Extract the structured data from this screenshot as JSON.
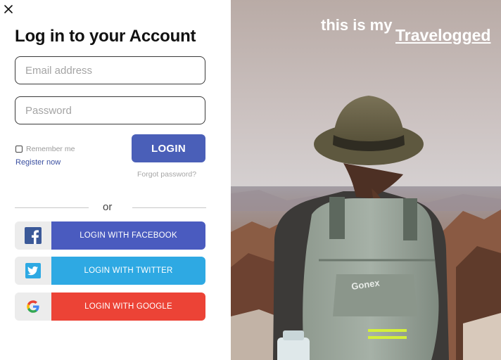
{
  "login_panel": {
    "title": "Log in to your Account",
    "email_placeholder": "Email address",
    "password_placeholder": "Password",
    "remember_label": "Remember me",
    "remember_checked": false,
    "register_link": "Register now",
    "login_button": "LOGIN",
    "forgot_link": "Forgot password?",
    "divider_text": "or",
    "social": {
      "facebook": "LOGIN WITH FACEBOOK",
      "twitter": "LOGIN WITH TWITTER",
      "google": "LOGIN WITH GOOGLE"
    }
  },
  "hero": {
    "tagline": "this is my",
    "brand": "Travelogged",
    "backpack_brand": "Gonex"
  },
  "colors": {
    "login_button": "#4a5fb8",
    "facebook": "#4a5bbf",
    "twitter": "#2ea9e3",
    "google": "#ec4336"
  },
  "icons": {
    "close": "close-icon",
    "facebook": "facebook-icon",
    "twitter": "twitter-icon",
    "google": "google-icon"
  }
}
